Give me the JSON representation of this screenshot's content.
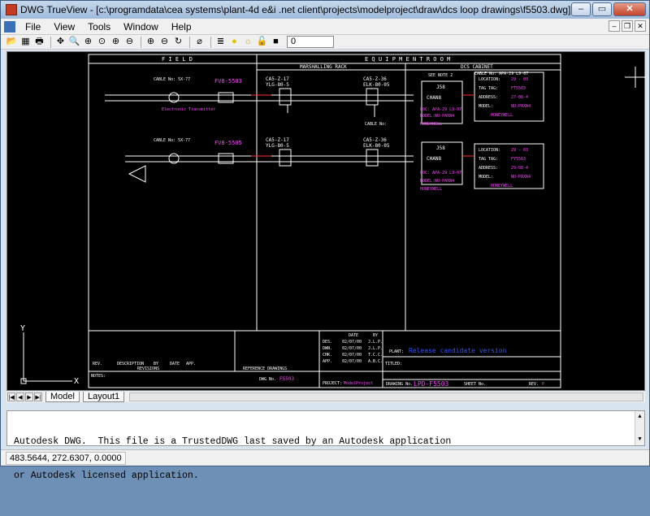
{
  "window": {
    "title": "DWG TrueView - [c:\\programdata\\cea systems\\plant-4d e&i .net client\\projects\\modelproject\\draw\\dcs loop drawings\\f5503.dwg]"
  },
  "menu": [
    "File",
    "View",
    "Tools",
    "Window",
    "Help"
  ],
  "toolbar": {
    "layer_value": "0"
  },
  "drawing": {
    "sections": [
      "F I E L D",
      "E Q U I P M E N T   R O O M",
      "MARSHALLING RACK",
      "DCS CABINET"
    ],
    "loop1": {
      "cable_field": "CABLE No: 5X-77",
      "field_tag": "FV8-5503",
      "instrument_desc": "Electronic Transmitter",
      "cab1": "CA5-Z-17",
      "cab1b": "YLG-80-5",
      "cab2": "CA5-Z-36",
      "cab2b": "ELK-80-05",
      "cab3_label": "CABLE No:",
      "note": "SEE NOTE 2",
      "chan": "CHAN8",
      "card": "J58",
      "cable_dcs": "CABLE No: APA-29 L9-07",
      "loc": "LOC: APA-29 L9-07",
      "model": "MODEL:NU-PAXN4",
      "vendor": "HONEYWELL",
      "info": [
        [
          "LOCATION:",
          "29 - 03"
        ],
        [
          "TAG TAG:",
          "FT5503"
        ],
        [
          "ADDRESS:",
          "27-08-4"
        ],
        [
          "MODEL:",
          "NU-PAXN4"
        ],
        [
          "",
          "HONEYWELL"
        ]
      ]
    },
    "loop2": {
      "cable_field": "CABLE No: 5X-77",
      "field_tag": "FV8-5505",
      "cab1": "CA5-Z-17",
      "cab1b": "YLG-80-5",
      "cab2": "CA5-Z-36",
      "cab2b": "ELK-80-05",
      "chan": "CHAN8",
      "card": "J58",
      "loc": "LOC: APA-29 L9-07",
      "model": "MODEL:NU-PAXN4",
      "vendor": "HONEYWELL",
      "info": [
        [
          "LOCATION:",
          "29 - 03"
        ],
        [
          "TAG TAG:",
          "FY5503"
        ],
        [
          "ADDRESS:",
          "29-08-4"
        ],
        [
          "MODEL:",
          "NU-PAXN4"
        ],
        [
          "",
          "HONEYWELL"
        ]
      ]
    },
    "titleblock": {
      "plant_label": "PLANT:",
      "plant_value": "Release candidate version",
      "title_label": "TITLED:",
      "project_label": "PROJECT:",
      "project_value": "ModelProject",
      "drawing_label": "DRAWING No.",
      "drawing_value": "LPD-F5503",
      "sheet_label": "SHEET No.",
      "rev_label": "REV.",
      "rev_value": "P",
      "dwg_no_label": "DWG No.",
      "dwg_no_value": "F5503",
      "notes": "NOTES:",
      "cols": [
        "REV.",
        "DESCRIPTION",
        "BY",
        "DATE",
        "APP."
      ],
      "revisions_label": "REVISIONS",
      "reference_label": "REFERENCE DRAWINGS",
      "date_header": [
        "DATE",
        "BY"
      ],
      "date_rows": [
        [
          "DES.",
          "02/07/00",
          "J.L.P."
        ],
        [
          "DWN.",
          "02/07/00",
          "J.L.P."
        ],
        [
          "CHK.",
          "02/07/00",
          "T.C.C."
        ],
        [
          "APP.",
          "02/07/00",
          "A.B.C."
        ]
      ]
    },
    "ucs_y": "Y",
    "ucs_x": "X"
  },
  "tabs": [
    "Model",
    "Layout1"
  ],
  "command": {
    "line1": "Autodesk DWG.  This file is a TrustedDWG last saved by an Autodesk application",
    "line2": "or Autodesk licensed application."
  },
  "status": {
    "coords": "483.5644, 272.6307, 0.0000"
  },
  "colors": {
    "magenta": "#ff44ff",
    "cyan": "#2ee6e6",
    "white": "#ffffff",
    "red": "#ff3030",
    "blue": "#3355ff",
    "yellow": "#ffff33"
  }
}
